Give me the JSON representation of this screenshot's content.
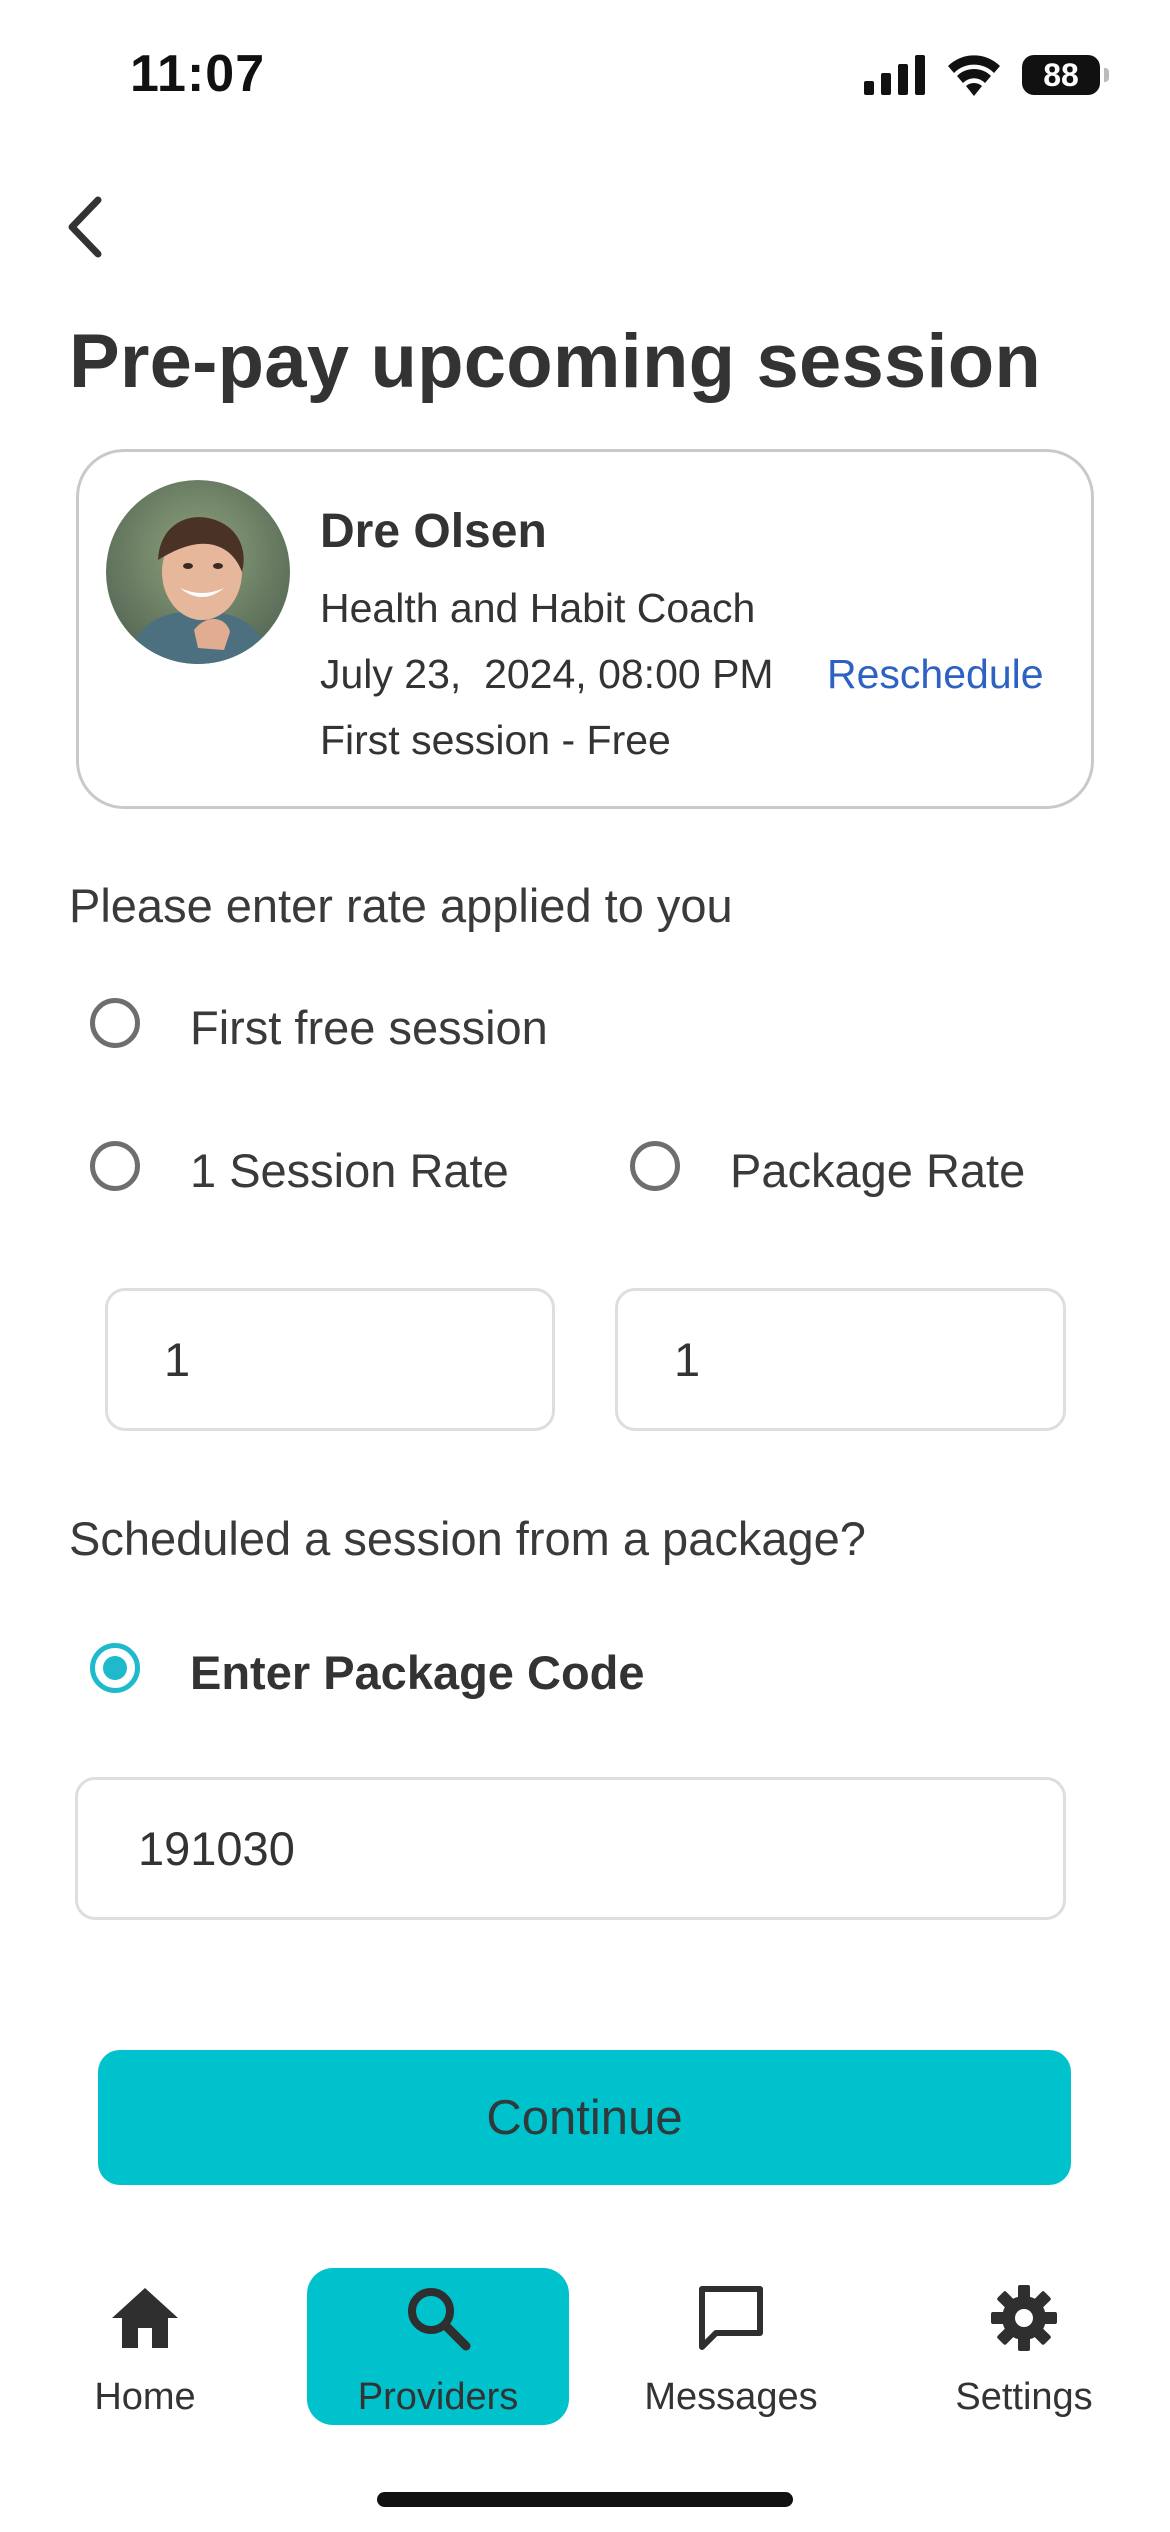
{
  "status_bar": {
    "time": "11:07",
    "battery": "88"
  },
  "header": {
    "title": "Pre-pay upcoming session"
  },
  "provider": {
    "name": "Dre Olsen",
    "role": "Health and Habit Coach",
    "date": "July 23,  2024, 08:00 PM",
    "reschedule_label": "Reschedule",
    "price": "First session - Free"
  },
  "rate_section": {
    "question": "Please enter rate applied to you",
    "options": [
      {
        "label": "First free session",
        "selected": false
      },
      {
        "label": "1 Session Rate",
        "selected": false
      },
      {
        "label": "Package Rate",
        "selected": false
      }
    ],
    "session_rate_value": "1",
    "package_rate_value": "1"
  },
  "package_section": {
    "question": "Scheduled a session from a package?",
    "option_label": "Enter Package Code",
    "selected": true,
    "code_value": "191030"
  },
  "actions": {
    "continue_label": "Continue"
  },
  "bottom_nav": {
    "items": [
      {
        "label": "Home",
        "icon": "home-icon",
        "active": false
      },
      {
        "label": "Providers",
        "icon": "search-icon",
        "active": true
      },
      {
        "label": "Messages",
        "icon": "message-icon",
        "active": false
      },
      {
        "label": "Settings",
        "icon": "gear-icon",
        "active": false
      }
    ]
  },
  "colors": {
    "accent": "#00c2cc",
    "link": "#2d61c2",
    "radio_selected": "#1fb9cc"
  }
}
